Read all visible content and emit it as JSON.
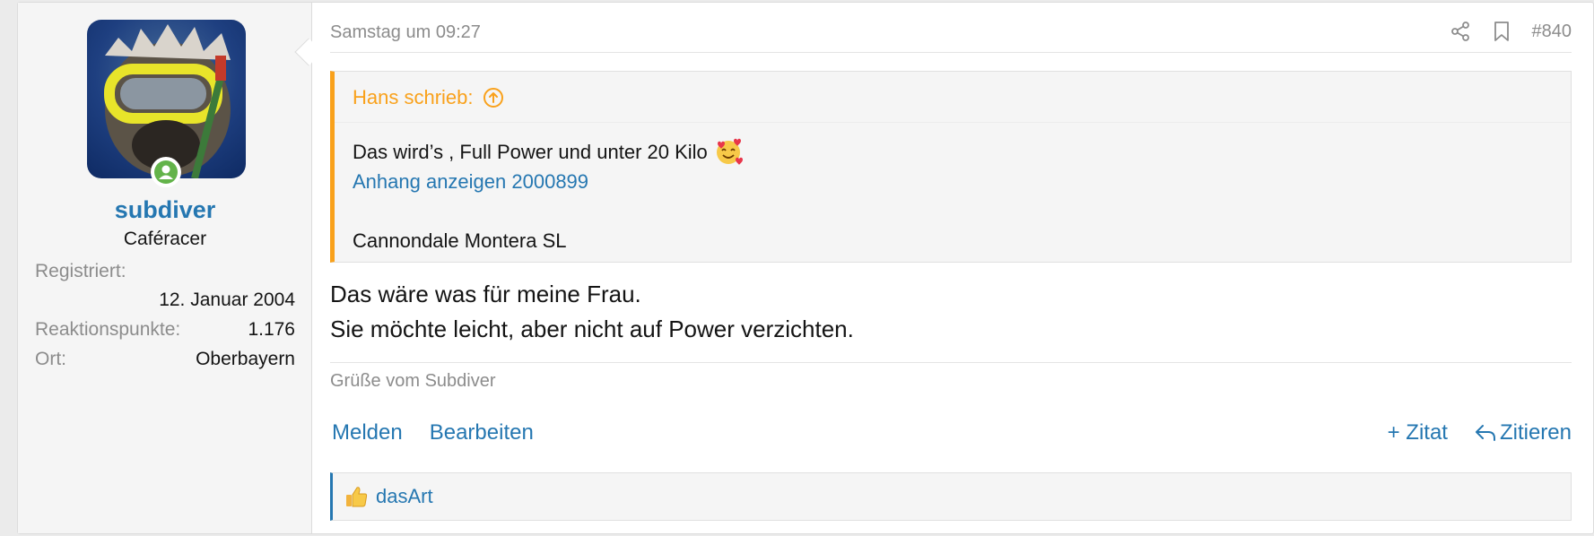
{
  "user": {
    "name": "subdiver",
    "title": "Caféracer",
    "fields": [
      {
        "label": "Registriert:",
        "value": "12. Januar 2004"
      },
      {
        "label": "Reaktionspunkte:",
        "value": "1.176"
      },
      {
        "label": "Ort:",
        "value": "Oberbayern"
      }
    ]
  },
  "post": {
    "date": "Samstag um 09:27",
    "number": "#840",
    "quote": {
      "author": "Hans schrieb:",
      "line1": "Das wird’s , Full Power und unter 20 Kilo",
      "attachment_link": "Anhang anzeigen 2000899",
      "line3": "Cannondale Montera SL"
    },
    "message": {
      "line1": "Das wäre was für meine Frau.",
      "line2": "Sie möchte leicht, aber nicht auf Power verzichten."
    },
    "signature": "Grüße vom Subdiver"
  },
  "actions": {
    "report": "Melden",
    "edit": "Bearbeiten",
    "multiquote": "+ Zitat",
    "reply": "Zitieren"
  },
  "reactions": {
    "users": "dasArt"
  },
  "colors": {
    "link": "#2577b1",
    "quote_accent": "#f9a11b",
    "online": "#63b34a"
  }
}
